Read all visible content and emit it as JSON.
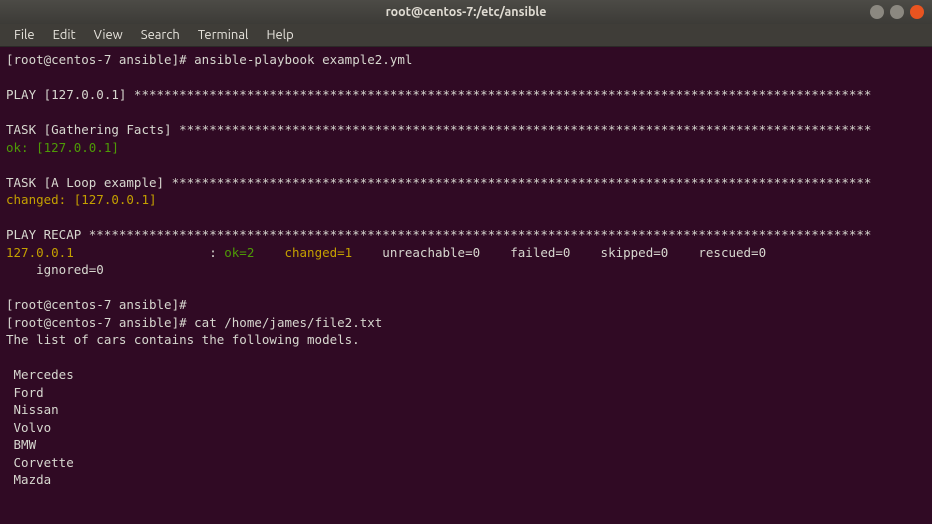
{
  "window": {
    "title": "root@centos-7:/etc/ansible"
  },
  "menu": {
    "file": "File",
    "edit": "Edit",
    "view": "View",
    "search": "Search",
    "terminal": "Terminal",
    "help": "Help"
  },
  "prompt": {
    "p1": "[root@centos-7 ansible]# ",
    "cmd1": "ansible-playbook example2.yml",
    "cmd2": "cat /home/james/file2.txt"
  },
  "play": {
    "hdr": "PLAY [127.0.0.1] **************************************************************************************************"
  },
  "task_facts": {
    "hdr": "TASK [Gathering Facts] ********************************************************************************************",
    "status": "ok: [127.0.0.1]"
  },
  "task_loop": {
    "hdr": "TASK [A Loop example] *********************************************************************************************",
    "status": "changed: [127.0.0.1]"
  },
  "recap": {
    "hdr": "PLAY RECAP ********************************************************************************************************",
    "host": "127.0.0.1",
    "sep": "                  : ",
    "ok": "ok=2",
    "sp1": "    ",
    "changed": "changed=1",
    "tail": "    unreachable=0    failed=0    skipped=0    rescued=0",
    "ignored": "    ignored=0"
  },
  "cat": {
    "header": "The list of cars contains the following models.",
    "l1": " Mercedes",
    "l2": " Ford",
    "l3": " Nissan",
    "l4": " Volvo",
    "l5": " BMW",
    "l6": " Corvette",
    "l7": " Mazda"
  }
}
